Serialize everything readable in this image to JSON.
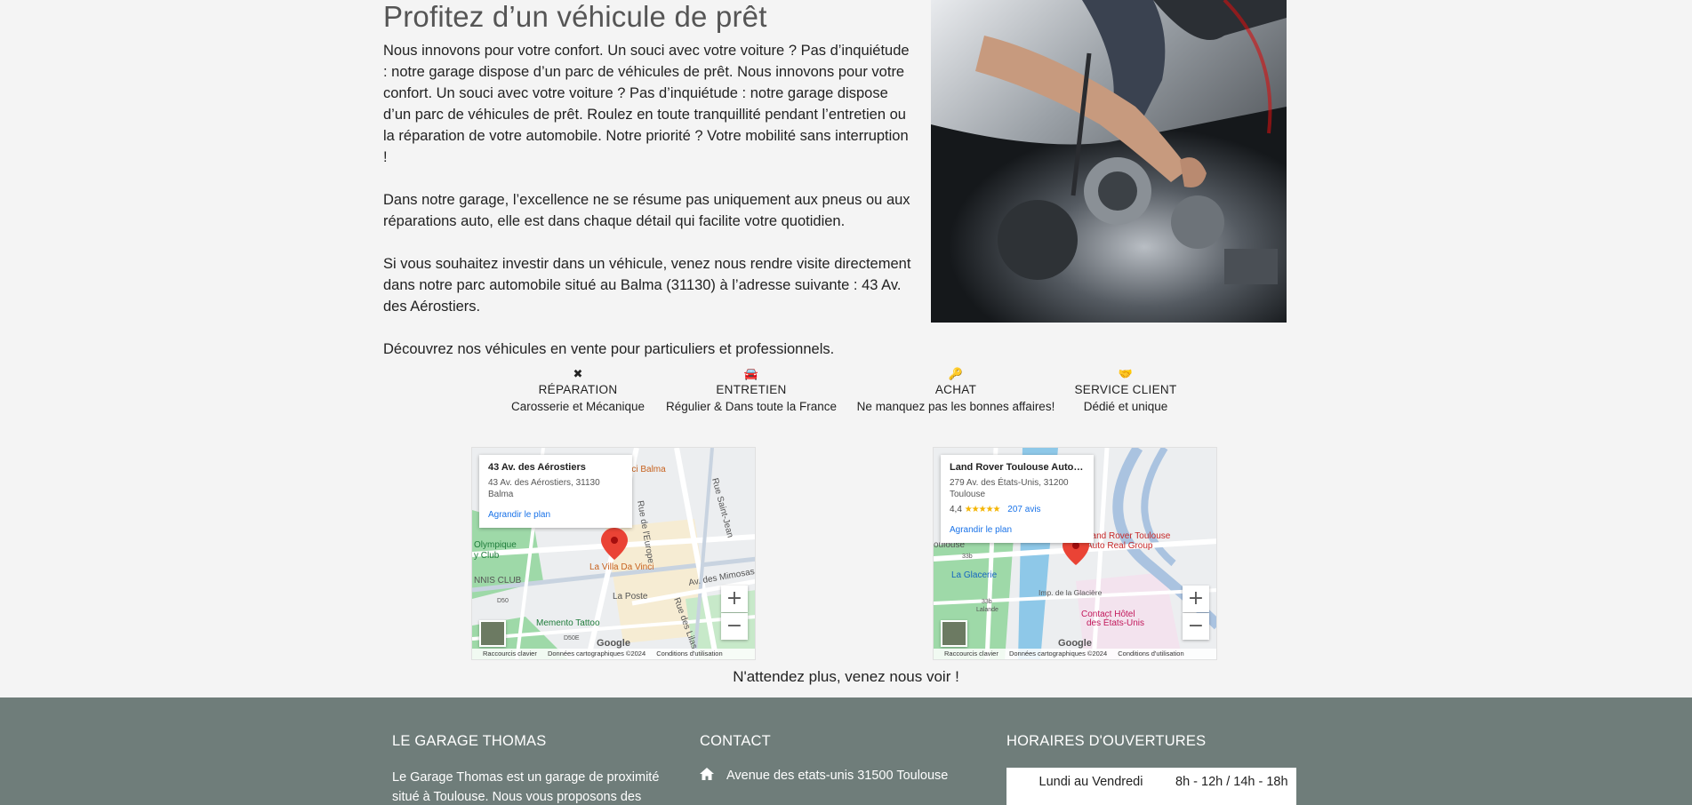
{
  "section": {
    "title": "Profitez d’un véhicule de prêt",
    "paragraphs": [
      "Nous innovons pour votre confort. Un souci avec votre voiture ? Pas d’inquiétude : notre garage dispose d’un parc de véhicules de prêt. Nous innovons pour votre confort. Un souci avec votre voiture ? Pas d’inquiétude : notre garage dispose d’un parc de véhicules de prêt. Roulez en toute tranquillité pendant l’entretien ou la réparation de votre automobile. Notre priorité ? Votre mobilité sans interruption !",
      "Dans notre garage, l’excellence ne se résume pas uniquement aux pneus ou aux réparations auto, elle est dans chaque détail qui facilite votre quotidien.",
      "Si vous souhaitez investir dans un véhicule, venez nous rendre visite directement dans notre parc automobile situé au Balma (31130) à l’adresse suivante : 43 Av. des Aérostiers.",
      "Découvrez nos véhicules en vente pour particuliers et professionnels."
    ]
  },
  "services": [
    {
      "icon": "wrench-screwdriver-icon",
      "glyph": "✖",
      "title": "Réparation",
      "subtitle": "Carosserie et Mécanique"
    },
    {
      "icon": "car-icon",
      "glyph": "🚘",
      "title": "Entretien",
      "subtitle": "Régulier & Dans toute la France"
    },
    {
      "icon": "key-icon",
      "glyph": "🔑",
      "title": "Achat",
      "subtitle": "Ne manquez pas les bonnes affaires!"
    },
    {
      "icon": "handshake-icon",
      "glyph": "🤝",
      "title": "Service Client",
      "subtitle": "Dédié et unique"
    }
  ],
  "maps": [
    {
      "card_title": "43 Av. des Aérostiers",
      "card_address": "43 Av. des Aérostiers, 31130 Balma",
      "card_link": "Agrandir le plan",
      "labels": [
        "za Bonici Balma",
        "Rue de l'Europe",
        "Rue Saint-Jean",
        "Olympique",
        "y Club",
        "La Villa Da Vinci",
        "NNIS CLUB",
        "La Poste",
        "Av. des Mimosas",
        "Rue des Lilas",
        "Memento Tattoo",
        "D50",
        "D50E"
      ],
      "brand": "Google",
      "attribution": [
        "Raccourcis clavier",
        "Données cartographiques ©2024",
        "Conditions d'utilisation"
      ]
    },
    {
      "card_title": "Land Rover Toulouse Auto Ré...",
      "card_address": "279 Av. des États-Unis, 31200 Toulouse",
      "card_rating": "4,4",
      "card_stars": "★★★★★",
      "card_reviews": "207 avis",
      "card_link": "Agrandir le plan",
      "labels": [
        "Land Rover Toulouse",
        "Auto Real Group",
        "La Glacerie",
        "Imp. de la Glacière",
        "Contact Hôtel",
        "des États-Unis",
        "oulouse",
        "33b",
        "33b",
        "Lalande"
      ],
      "brand": "Google",
      "attribution": [
        "Raccourcis clavier",
        "Données cartographiques ©2024",
        "Conditions d'utilisation"
      ]
    }
  ],
  "map_controls": {
    "zoom_in": "+",
    "zoom_out": "−"
  },
  "cta": "N'attendez plus, venez nous voir !",
  "footer": {
    "about": {
      "title": "Le Garage Thomas",
      "text": "Le Garage Thomas est un garage de proximité situé à Toulouse. Nous vous proposons des services de"
    },
    "contact": {
      "title": "Contact",
      "address": "Avenue des etats-unis 31500 Toulouse"
    },
    "hours": {
      "title": "Horaires d'ouvertures",
      "rows": [
        {
          "day": "Lundi au Vendredi",
          "time": "8h - 12h / 14h - 18h"
        }
      ]
    }
  }
}
